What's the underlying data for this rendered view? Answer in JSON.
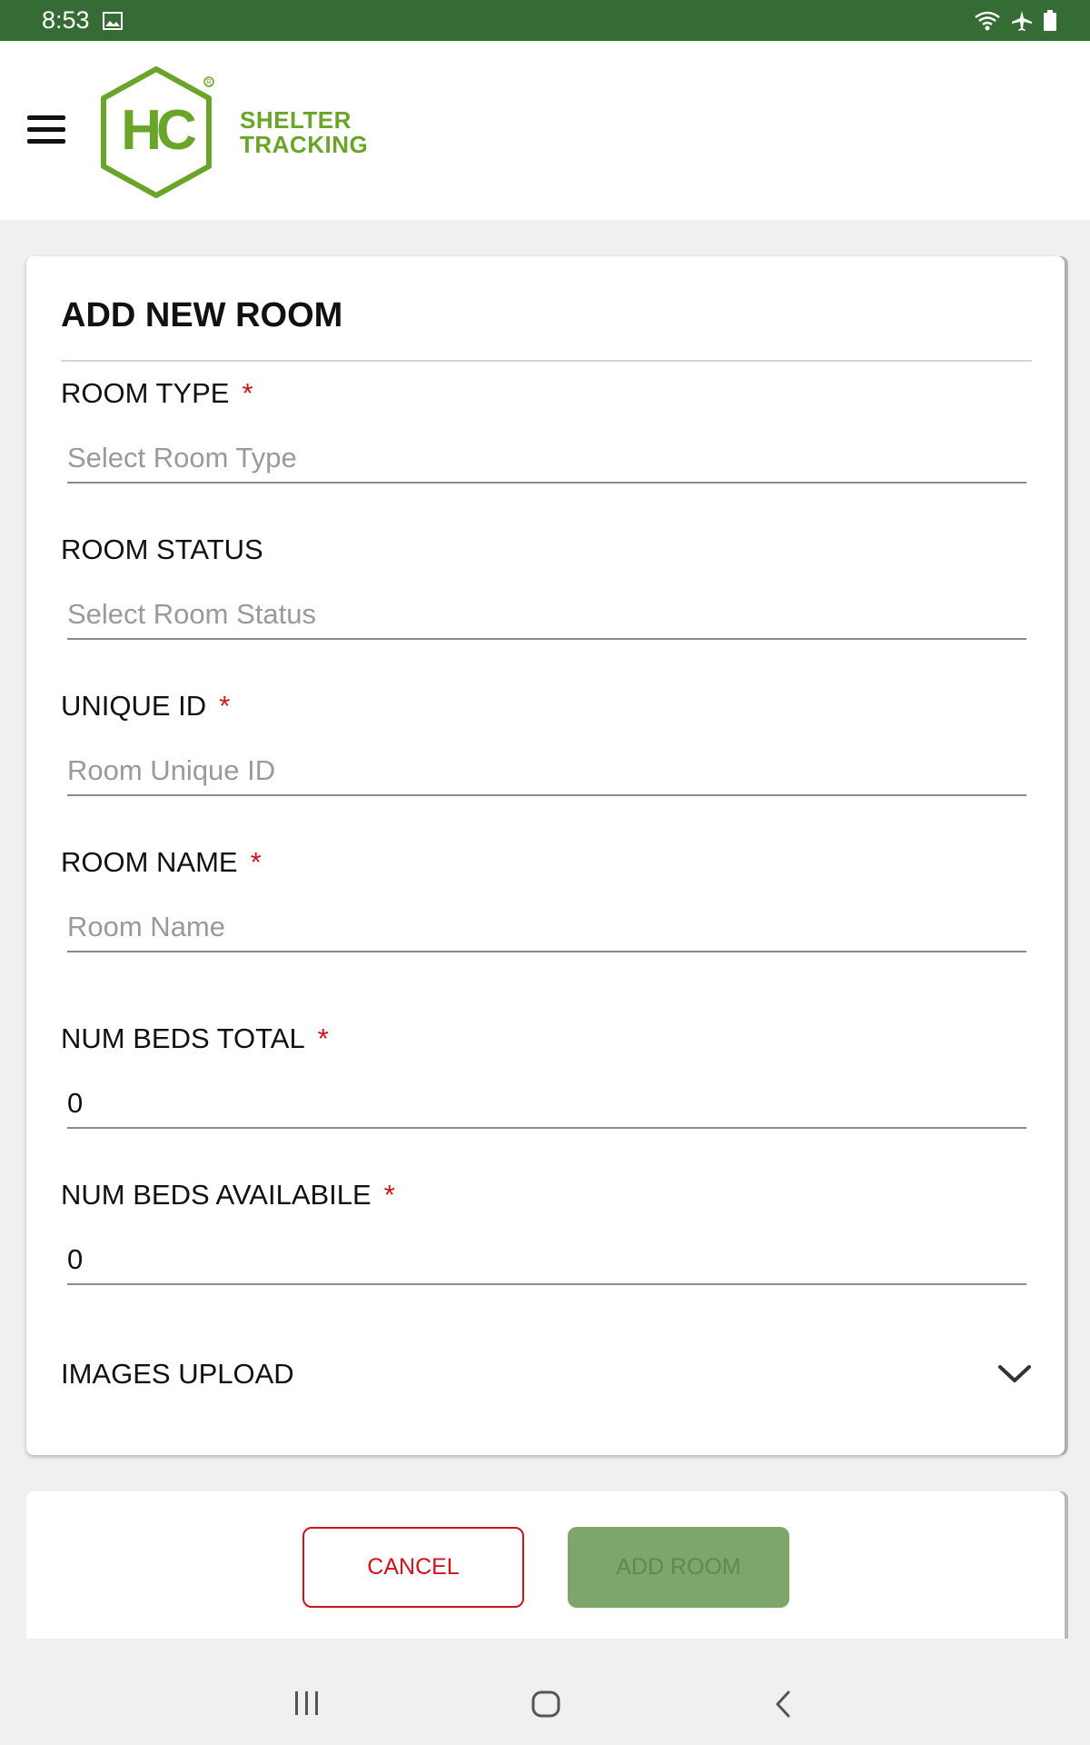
{
  "status_bar": {
    "time": "8:53",
    "icons": [
      "image-icon",
      "wifi-icon",
      "airplane-icon",
      "battery-icon"
    ]
  },
  "header": {
    "logo_letters": "HC",
    "logo_line1": "SHELTER",
    "logo_line2": "TRACKING",
    "brand_color": "#6aa52a"
  },
  "form": {
    "title": "ADD NEW ROOM",
    "fields": [
      {
        "label": "ROOM TYPE",
        "required": "*",
        "placeholder": "Select Room Type",
        "value": ""
      },
      {
        "label": "ROOM STATUS",
        "required": "",
        "placeholder": "Select Room Status",
        "value": ""
      },
      {
        "label": "UNIQUE ID",
        "required": "*",
        "placeholder": "Room Unique ID",
        "value": ""
      },
      {
        "label": "ROOM NAME",
        "required": "*",
        "placeholder": "Room Name",
        "value": ""
      },
      {
        "label": "NUM BEDS TOTAL",
        "required": "*",
        "placeholder": "",
        "value": "0"
      },
      {
        "label": "NUM BEDS AVAILABILE",
        "required": "*",
        "placeholder": "",
        "value": "0"
      }
    ],
    "images_upload_label": "IMAGES UPLOAD"
  },
  "buttons": {
    "cancel": "CANCEL",
    "add_room": "ADD ROOM"
  },
  "colors": {
    "status_bar": "#356c35",
    "required": "#d0121b",
    "cancel": "#d0121b",
    "add_room_bg": "#7ea66b"
  }
}
